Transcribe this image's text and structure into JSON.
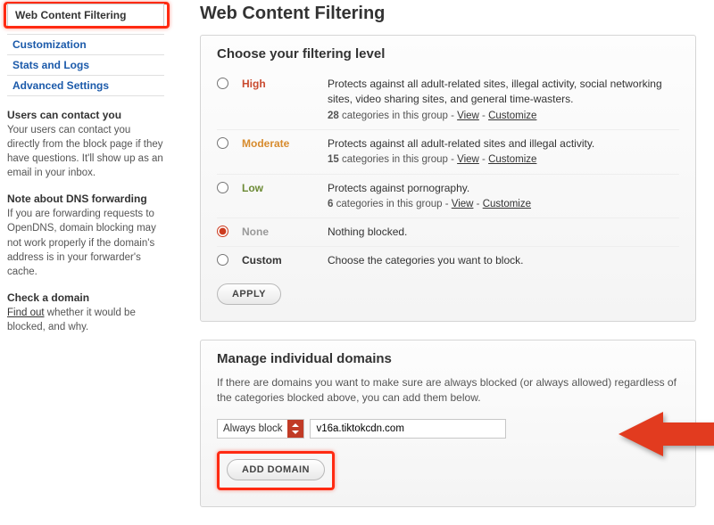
{
  "sidebar": {
    "active_tab": "Web Content Filtering",
    "links": [
      "Customization",
      "Stats and Logs",
      "Advanced Settings"
    ],
    "sections": [
      {
        "heading": "Users can contact you",
        "text": "Your users can contact you directly from the block page if they have questions. It'll show up as an email in your inbox."
      },
      {
        "heading": "Note about DNS forwarding",
        "text": "If you are forwarding requests to OpenDNS, domain blocking may not work properly if the domain's address is in your forwarder's cache."
      },
      {
        "heading": "Check a domain",
        "link": "Find out",
        "rest": " whether it would be blocked, and why."
      }
    ]
  },
  "page_title": "Web Content Filtering",
  "filtering": {
    "heading": "Choose your filtering level",
    "apply_label": "APPLY",
    "selected": "none",
    "levels": [
      {
        "key": "high",
        "name": "High",
        "desc": "Protects against all adult-related sites, illegal activity, social networking sites, video sharing sites, and general time-wasters.",
        "count": "28",
        "meta_tmpl": " categories in this group - ",
        "view": "View",
        "dash": " - ",
        "cust": "Customize"
      },
      {
        "key": "moderate",
        "name": "Moderate",
        "desc": "Protects against all adult-related sites and illegal activity.",
        "count": "15",
        "meta_tmpl": " categories in this group - ",
        "view": "View",
        "dash": " - ",
        "cust": "Customize"
      },
      {
        "key": "low",
        "name": "Low",
        "desc": "Protects against pornography.",
        "count": "6",
        "meta_tmpl": " categories in this group - ",
        "view": "View",
        "dash": " - ",
        "cust": "Customize"
      },
      {
        "key": "none",
        "name": "None",
        "desc": "Nothing blocked."
      },
      {
        "key": "custom",
        "name": "Custom",
        "desc": "Choose the categories you want to block."
      }
    ]
  },
  "domains": {
    "heading": "Manage individual domains",
    "note": "If there are domains you want to make sure are always blocked (or always allowed) regardless of the categories blocked above, you can add them below.",
    "select_value": "Always block",
    "input_value": "v16a.tiktokcdn.com",
    "add_label": "ADD DOMAIN"
  }
}
